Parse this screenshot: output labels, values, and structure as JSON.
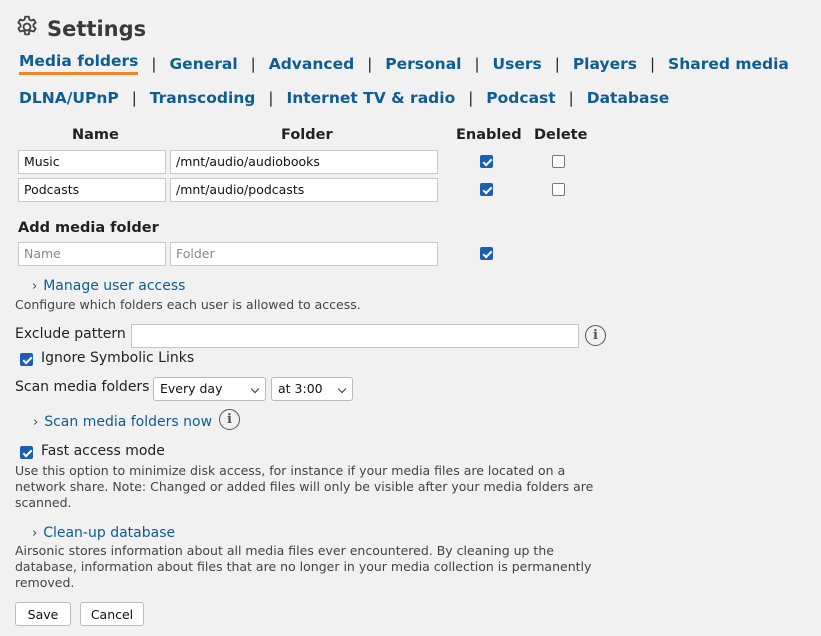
{
  "page": {
    "title": "Settings",
    "icon": "gear-icon"
  },
  "tabs_row1": [
    {
      "label": "Media folders",
      "active": true
    },
    {
      "label": "General"
    },
    {
      "label": "Advanced"
    },
    {
      "label": "Personal"
    },
    {
      "label": "Users"
    },
    {
      "label": "Players"
    },
    {
      "label": "Shared media"
    }
  ],
  "tabs_row2": [
    {
      "label": "DLNA/UPnP"
    },
    {
      "label": "Transcoding"
    },
    {
      "label": "Internet TV & radio"
    },
    {
      "label": "Podcast"
    },
    {
      "label": "Database"
    }
  ],
  "separator": "|",
  "folders_table": {
    "headers": {
      "name": "Name",
      "folder": "Folder",
      "enabled": "Enabled",
      "delete": "Delete"
    },
    "rows": [
      {
        "name": "Music",
        "folder": "/mnt/audio/audiobooks",
        "enabled": true,
        "delete": false
      },
      {
        "name": "Podcasts",
        "folder": "/mnt/audio/podcasts",
        "enabled": true,
        "delete": false
      }
    ]
  },
  "add_folder": {
    "heading": "Add media folder",
    "name_placeholder": "Name",
    "folder_placeholder": "Folder",
    "enabled": true
  },
  "manage_access": {
    "link": "Manage user access",
    "note": "Configure which folders each user is allowed to access."
  },
  "exclude": {
    "label": "Exclude pattern",
    "value": "",
    "info_icon": "info-icon"
  },
  "ignore_symlinks": {
    "label": "Ignore Symbolic Links",
    "checked": true
  },
  "scan": {
    "label": "Scan media folders",
    "interval": "Every day",
    "time": "at 3:00",
    "now_link": "Scan media folders now",
    "info_icon": "info-icon"
  },
  "fast_access": {
    "label": "Fast access mode",
    "checked": true,
    "note": "Use this option to minimize disk access, for instance if your media files are located on a network share. Note: Changed or added files will only be visible after your media folders are scanned."
  },
  "cleanup": {
    "link": "Clean-up database",
    "note": "Airsonic stores information about all media files ever encountered. By cleaning up the database, information about files that are no longer in your media collection is permanently removed."
  },
  "buttons": {
    "save": "Save",
    "cancel": "Cancel"
  },
  "colors": {
    "link": "#0e5d93",
    "active_underline": "#ee8526",
    "checkbox": "#1a5fb4",
    "background": "#f1f1f1"
  }
}
